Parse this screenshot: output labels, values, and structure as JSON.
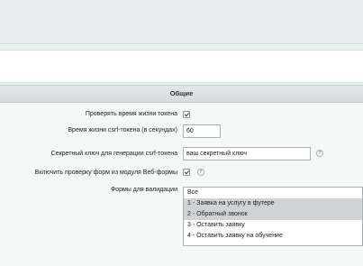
{
  "section": {
    "title": "Общие"
  },
  "fields": {
    "check_token_lifetime": {
      "label": "Проверять время жизни токена",
      "checked": true
    },
    "csrf_lifetime": {
      "label": "Время жизни csrf-токена (в секундах)",
      "value": "60"
    },
    "secret_key": {
      "label": "Секретный ключ для генерации csrf-токена",
      "value": "ваш секретный ключ"
    },
    "enable_webforms": {
      "label": "Включить проверку форм из модуля Веб-формы",
      "checked": true
    },
    "validation_forms": {
      "label": "Формы для валидации",
      "options": [
        {
          "text": "Все",
          "selected": false
        },
        {
          "text": "1 - Заявка на услугу в футере",
          "selected": true
        },
        {
          "text": "2 - Обратный звонок",
          "selected": true
        },
        {
          "text": "3 - Оставить заявку",
          "selected": false
        },
        {
          "text": "4 - Оставить заявку на обучение",
          "selected": false
        }
      ]
    }
  },
  "icons": {
    "help": "help-circle-icon",
    "help_glyph": "?"
  },
  "colors": {
    "header_bg": "#d9e0e3",
    "selected_option": "#cfd3d5",
    "page_bg": "#ecf0f1"
  }
}
